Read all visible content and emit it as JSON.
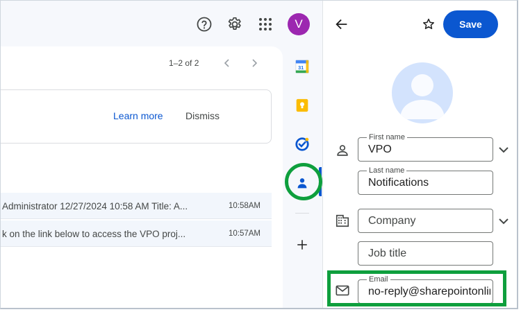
{
  "topbar": {
    "help_icon": "help-circle-icon",
    "settings_icon": "gear-icon",
    "apps_icon": "apps-grid-icon",
    "account_initial": "V",
    "account_color": "#9c27b0"
  },
  "mail": {
    "pager_text": "1–2 of 2",
    "notice": {
      "learn_more": "Learn more",
      "dismiss": "Dismiss"
    },
    "rows": [
      {
        "snippet": "Administrator 12/27/2024 10:58 AM Title: A...",
        "time": "10:58AM"
      },
      {
        "snippet": "k on the link below to access the VPO proj...",
        "time": "10:57AM"
      }
    ]
  },
  "side_rail": {
    "apps": [
      "calendar-icon",
      "keep-icon",
      "tasks-icon",
      "contacts-icon"
    ],
    "add_icon": "plus-icon",
    "calendar_day": "31"
  },
  "contact": {
    "save_label": "Save",
    "first_name": {
      "label": "First name",
      "value": "VPO"
    },
    "last_name": {
      "label": "Last name",
      "value": "Notifications"
    },
    "company": {
      "placeholder": "Company"
    },
    "job_title": {
      "placeholder": "Job title"
    },
    "email": {
      "label": "Email",
      "value": "no-reply@sharepointonline.com"
    }
  },
  "colors": {
    "accent": "#0b57d0",
    "highlight": "#0e9f3d",
    "background": "#f6f8fc"
  }
}
